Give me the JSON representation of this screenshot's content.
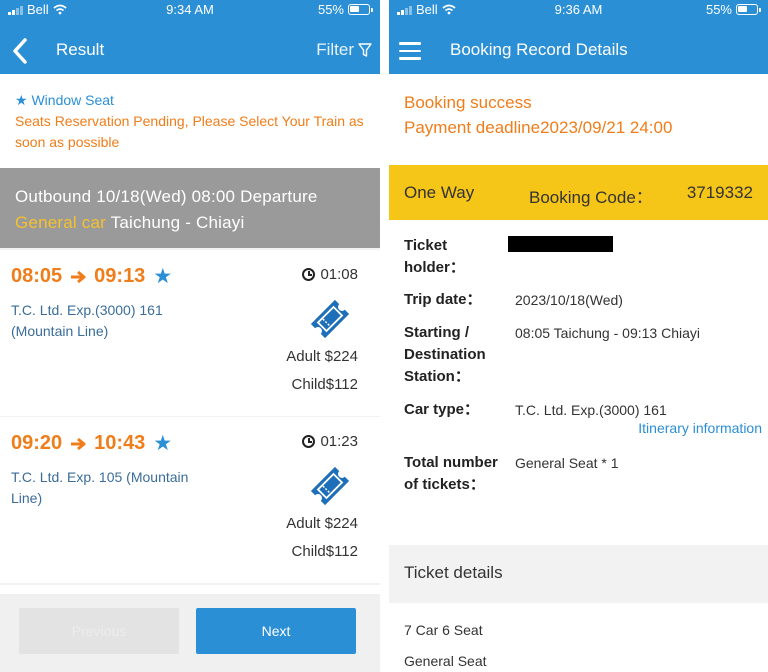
{
  "left": {
    "status": {
      "carrier": "Bell",
      "time": "9:34 AM",
      "battery": "55%"
    },
    "nav": {
      "title": "Result",
      "filter_label": "Filter"
    },
    "notice": {
      "window_seat": "Window Seat",
      "pending": "Seats Reservation Pending, Please Select Your Train as soon as possible"
    },
    "outbound": {
      "line1": "Outbound 10/18(Wed) 08:00 Departure",
      "car_type": "General car",
      "route": "Taichung - Chiayi"
    },
    "trains": [
      {
        "dep": "08:05",
        "arr": "09:13",
        "duration": "01:08",
        "name": "T.C. Ltd. Exp.(3000) 161 (Mountain Line)",
        "adult": "Adult $224",
        "child": "Child$112"
      },
      {
        "dep": "09:20",
        "arr": "10:43",
        "duration": "01:23",
        "name": "T.C. Ltd. Exp. 105 (Mountain Line)",
        "adult": "Adult $224",
        "child": "Child$112"
      }
    ],
    "buttons": {
      "previous": "Previous",
      "next": "Next"
    }
  },
  "right": {
    "status": {
      "carrier": "Bell",
      "time": "9:36 AM",
      "battery": "55%"
    },
    "nav": {
      "title": "Booking Record Details"
    },
    "success": "Booking success",
    "deadline": "Payment deadline2023/09/21 24:00",
    "booking_bar": {
      "type": "One Way",
      "code_label": "Booking Code：",
      "code": "3719332"
    },
    "fields": {
      "ticket_holder_label": "Ticket holder：",
      "trip_date_label": "Trip date：",
      "trip_date": "2023/10/18(Wed)",
      "station_label": "Starting / Destination Station：",
      "station": "08:05 Taichung - 09:13 Chiayi",
      "car_type_label": "Car type：",
      "car_type": "T.C. Ltd. Exp.(3000) 161",
      "itinerary_link": "Itinerary information",
      "total_label": "Total number of tickets：",
      "total": "General Seat * 1"
    },
    "ticket_details": {
      "header": "Ticket details",
      "seat": "7 Car 6 Seat",
      "seat_type": "General Seat"
    }
  },
  "colors": {
    "primary": "#2b8fd6",
    "accent": "#ef7d1a",
    "highlight": "#f5c518",
    "banner_gray": "#9a9a9a"
  },
  "icons": [
    "back-icon",
    "filter-icon",
    "star-icon",
    "arrow-right-icon",
    "clock-icon",
    "ticket-icon",
    "menu-icon",
    "wifi-icon",
    "battery-icon"
  ]
}
